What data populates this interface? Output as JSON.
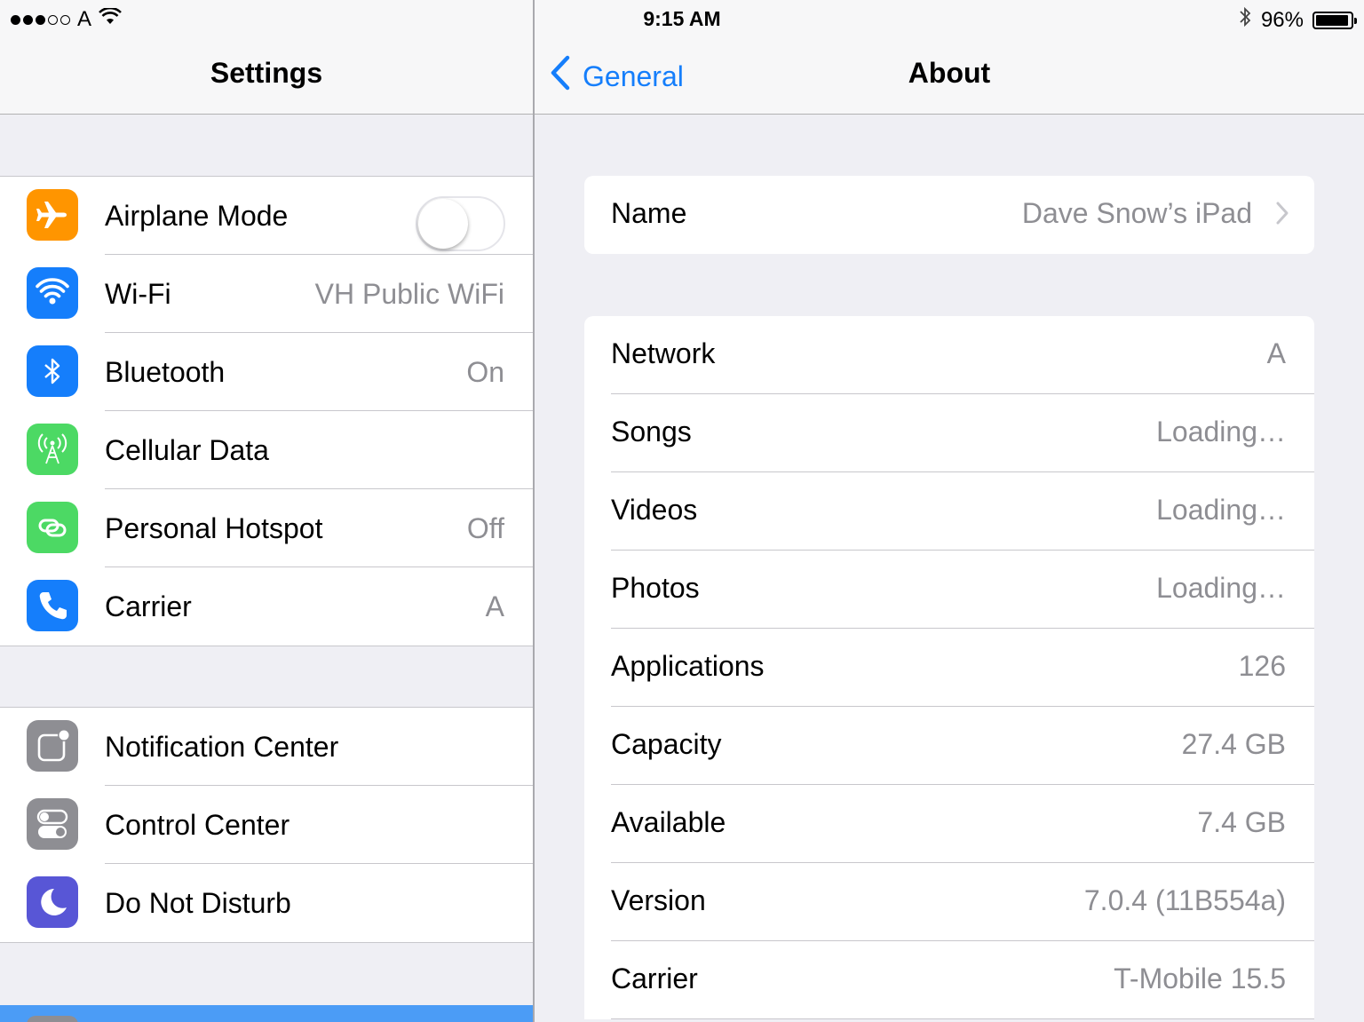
{
  "status_bar": {
    "carrier": "A",
    "time": "9:15 AM",
    "battery": "96%",
    "battery_level": 0.96
  },
  "master": {
    "title": "Settings",
    "groups": [
      [
        {
          "id": "airplane-mode",
          "label": "Airplane Mode",
          "icon": "airplane-icon",
          "color": "#ff9500",
          "toggle": false
        },
        {
          "id": "wifi",
          "label": "Wi-Fi",
          "value": "VH Public WiFi",
          "icon": "wifi-icon",
          "color": "#157efb"
        },
        {
          "id": "bluetooth",
          "label": "Bluetooth",
          "value": "On",
          "icon": "bluetooth-icon",
          "color": "#157efb"
        },
        {
          "id": "cellular-data",
          "label": "Cellular Data",
          "icon": "cellular-antenna-icon",
          "color": "#4cd964"
        },
        {
          "id": "personal-hotspot",
          "label": "Personal Hotspot",
          "value": "Off",
          "icon": "hotspot-link-icon",
          "color": "#4cd964"
        },
        {
          "id": "carrier",
          "label": "Carrier",
          "value": "A",
          "icon": "phone-icon",
          "color": "#157efb"
        }
      ],
      [
        {
          "id": "notification-center",
          "label": "Notification Center",
          "icon": "notification-icon",
          "color": "#8e8e93"
        },
        {
          "id": "control-center",
          "label": "Control Center",
          "icon": "switches-icon",
          "color": "#8e8e93"
        },
        {
          "id": "do-not-disturb",
          "label": "Do Not Disturb",
          "icon": "moon-icon",
          "color": "#5856d6"
        }
      ]
    ]
  },
  "detail": {
    "back_label": "General",
    "title": "About",
    "name_row": {
      "label": "Name",
      "value": "Dave Snow’s iPad"
    },
    "info_rows": [
      {
        "label": "Network",
        "value": "A"
      },
      {
        "label": "Songs",
        "value": "Loading…"
      },
      {
        "label": "Videos",
        "value": "Loading…"
      },
      {
        "label": "Photos",
        "value": "Loading…"
      },
      {
        "label": "Applications",
        "value": "126"
      },
      {
        "label": "Capacity",
        "value": "27.4 GB"
      },
      {
        "label": "Available",
        "value": "7.4 GB"
      },
      {
        "label": "Version",
        "value": "7.0.4 (11B554a)"
      },
      {
        "label": "Carrier",
        "value": "T-Mobile 15.5"
      }
    ]
  }
}
